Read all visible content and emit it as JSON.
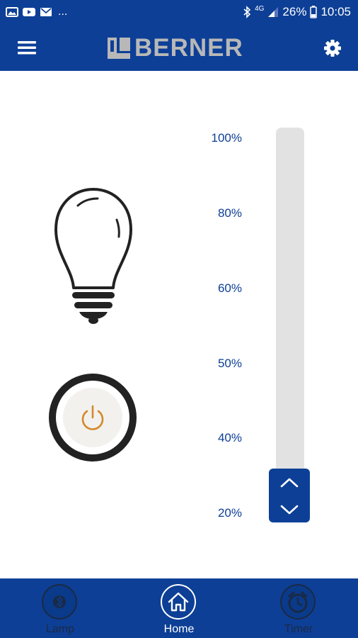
{
  "status_bar": {
    "overflow": "...",
    "network": "4G",
    "battery": "26%",
    "time": "10:05",
    "icons": [
      "image-icon",
      "youtube-icon",
      "mail-icon",
      "bluetooth-icon",
      "signal-icon",
      "battery-icon"
    ]
  },
  "app_bar": {
    "brand": "BERNER",
    "menu_icon": "hamburger-menu-icon",
    "settings_icon": "gear-icon"
  },
  "lamp": {
    "icon": "light-bulb-icon",
    "power_icon": "power-icon",
    "power_accent": "#d4892a"
  },
  "dimmer": {
    "labels": [
      "100%",
      "80%",
      "60%",
      "50%",
      "40%",
      "20%"
    ],
    "level_percent": 20,
    "handle_icons": [
      "chevron-up-icon",
      "chevron-down-icon"
    ]
  },
  "bottom_nav": {
    "items": [
      {
        "label": "Lamp",
        "icon": "bluetooth-icon",
        "active": false
      },
      {
        "label": "Home",
        "icon": "home-icon",
        "active": true
      },
      {
        "label": "Timer",
        "icon": "alarm-clock-icon",
        "active": false
      }
    ]
  },
  "colors": {
    "primary": "#0d3f96",
    "track": "#e2e2e2",
    "logo_gray": "#b8b8b8"
  }
}
